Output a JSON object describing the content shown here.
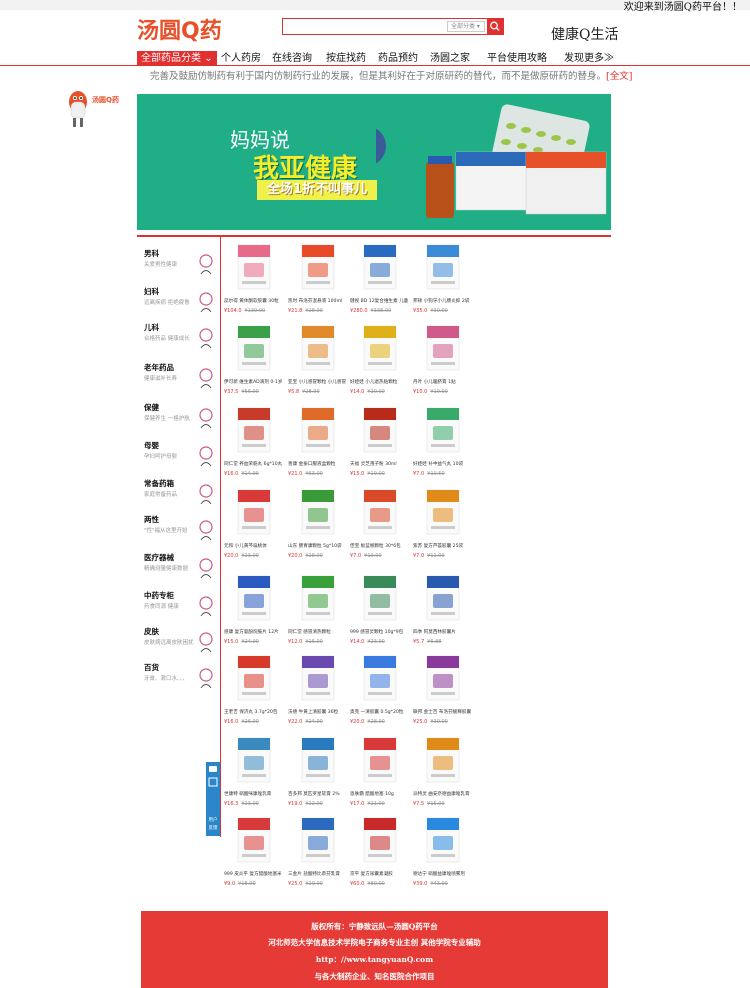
{
  "header": {
    "welcome": "欢迎来到汤圆Q药平台！！",
    "logo_text": "汤圆Q药",
    "search_placeholder": "",
    "search_category": "全部分类",
    "tagline": "健康Q生活"
  },
  "nav": {
    "category_label": "全部药品分类",
    "items": [
      "个人药房",
      "在线咨询",
      "按症找药",
      "药品预约",
      "汤圆之家",
      "平台使用攻略",
      "发现更多≫"
    ]
  },
  "notice": {
    "text": "完善及鼓励仿制药有利于国内仿制药行业的发展，但是其利好在于对原研药的替代，而不是做原研药的替身。",
    "link": "[全文]"
  },
  "mascot_text": "汤圆Q药",
  "banner": {
    "line1": "妈妈说",
    "line2": "我亚健康",
    "line3": "全场1折不叫事儿"
  },
  "categories": [
    {
      "title": "男科",
      "sub": "关爱男性健康",
      "icon": "male-icon"
    },
    {
      "title": "妇科",
      "sub": "远离疾病 拒绝疲惫",
      "icon": "female-icon"
    },
    {
      "title": "儿科",
      "sub": "合格药品 健康成长",
      "icon": "child-icon"
    },
    {
      "title": "老年药品",
      "sub": "健康滋补长寿",
      "icon": "elderly-icon"
    },
    {
      "title": "保健",
      "sub": "保健养生 一格护航",
      "icon": "health-icon"
    },
    {
      "title": "母婴",
      "sub": "孕妇呵护母婴",
      "icon": "mother-baby-icon"
    },
    {
      "title": "常备药箱",
      "sub": "家庭常备药品",
      "icon": "medicine-box-icon"
    },
    {
      "title": "两性",
      "sub": "\"性\"福从这里开始",
      "icon": "gender-icon"
    },
    {
      "title": "医疗器械",
      "sub": "精确测量健康数据",
      "icon": "thermometer-icon"
    },
    {
      "title": "中药专柜",
      "sub": "药食同源 健康",
      "icon": "herb-icon"
    },
    {
      "title": "皮肤",
      "sub": "皮肤病远离皮肤困扰",
      "icon": "skin-icon"
    },
    {
      "title": "百货",
      "sub": "牙膏、漱口水、、、",
      "icon": "goods-icon"
    }
  ],
  "products": [
    {
      "name": "蕊尔得 黄体酮软胶囊 30粒",
      "price": "¥104.0",
      "old": "¥139.00",
      "color": "#e86a8a"
    },
    {
      "name": "凯时 布洛芬混悬液 100ml",
      "price": "¥21.8",
      "old": "¥28.00",
      "color": "#e84a2a"
    },
    {
      "name": "健视 BD 12复合维生素 儿童",
      "price": "¥280.0",
      "old": "¥338.00",
      "color": "#2a6abf"
    },
    {
      "name": "邦顿 小狗牙小儿肠炎抑 2袋",
      "price": "¥35.0",
      "old": "¥39.00",
      "color": "#3a8ad6"
    },
    {
      "name": "伊可新 维生素AD滴剂 0-1岁",
      "price": "¥37.5",
      "old": "¥56.00",
      "color": "#3aa04a"
    },
    {
      "name": "亚宝 小儿感冒颗粒 小儿感冒",
      "price": "¥5.8",
      "old": "¥28.00",
      "color": "#e08a2a"
    },
    {
      "name": "好娃娃 小儿退热贴颗粒",
      "price": "¥14.0",
      "old": "¥20.00",
      "color": "#e0b01a"
    },
    {
      "name": "丹叶 小儿暖脐膏 1贴",
      "price": "¥10.0",
      "old": "¥19.00",
      "color": "#d05a8a"
    },
    {
      "name": "同仁堂 养血荣筋丸 6g*10丸",
      "price": "¥16.0",
      "old": "¥14.99",
      "color": "#c83a2a"
    },
    {
      "name": "善康 金振口服液盒颗粒",
      "price": "¥21.0",
      "old": "¥63.00",
      "color": "#e06a2a"
    },
    {
      "name": "天福 灵芝孢子粉 30ml",
      "price": "¥15.0",
      "old": "¥19.00",
      "color": "#b82a1a"
    },
    {
      "name": "好娃娃 补中益气丸 10袋",
      "price": "¥7.0",
      "old": "¥10.50",
      "color": "#3aaa6a"
    },
    {
      "name": "元和 小儿黄芩扁桃体",
      "price": "¥20.0",
      "old": "¥23.00",
      "color": "#d83a3a"
    },
    {
      "name": "山东 肠胃康颗粒 5g*10袋",
      "price": "¥20.0",
      "old": "¥28.00",
      "color": "#3a9a3a"
    },
    {
      "name": "佳宝 板蓝根颗粒 30*6包",
      "price": "¥7.0",
      "old": "¥19.00",
      "color": "#d84a2a"
    },
    {
      "name": "紫苏 复方芦荟胶囊 25袋",
      "price": "¥7.0",
      "old": "¥11.00",
      "color": "#e08a1a"
    },
    {
      "name": "感康 复方氨酚烷胺片 12片",
      "price": "¥15.0",
      "old": "¥24.00",
      "color": "#2a5abf"
    },
    {
      "name": "同仁堂 感冒清热颗粒",
      "price": "¥12.0",
      "old": "¥15.00",
      "color": "#3aa03a"
    },
    {
      "name": "999 感冒灵颗粒 10g*9包",
      "price": "¥14.0",
      "old": "¥23.00",
      "color": "#3a8a5a"
    },
    {
      "name": "四季 阿莫西林胶囊片",
      "price": "¥5.7",
      "old": "¥6.88",
      "color": "#2a5aaf"
    },
    {
      "name": "王老吉 保济丸 3.7g*20包",
      "price": "¥16.0",
      "old": "¥26.00",
      "color": "#d83a2a"
    },
    {
      "name": "沃德 牛黄上清胶囊 36粒",
      "price": "¥22.0",
      "old": "¥24.00",
      "color": "#6a4aaf"
    },
    {
      "name": "奥克 一清胶囊 0.5g*20粒",
      "price": "¥20.0",
      "old": "¥28.00",
      "color": "#3a7adf"
    },
    {
      "name": "联邦 金士百 布洛芬缓释胶囊",
      "price": "¥25.0",
      "old": "¥39.00",
      "color": "#8a3a9a"
    },
    {
      "name": "世康特 硝酸咪康唑乳膏",
      "price": "¥16.3",
      "old": "¥23.00",
      "color": "#3a8abf"
    },
    {
      "name": "百多邦 莫匹罗星软膏 2%",
      "price": "¥19.0",
      "old": "¥22.00",
      "color": "#2a7abf"
    },
    {
      "name": "恩肤霜 醋酸地塞 10g",
      "price": "¥17.0",
      "old": "¥21.00",
      "color": "#d83a3a"
    },
    {
      "name": "派特灵 曲安奈德益康唑乳膏",
      "price": "¥7.5",
      "old": "¥15.00",
      "color": "#e08a1a"
    },
    {
      "name": "999 皮炎平 复方醋酸地塞米",
      "price": "¥9.0",
      "old": "¥18.00",
      "color": "#d83a3a"
    },
    {
      "name": "三金片 盐酸特比萘芬乳膏",
      "price": "¥25.0",
      "old": "¥29.00",
      "color": "#2a6abf"
    },
    {
      "name": "京平 复方尿囊素凝胶",
      "price": "¥60.0",
      "old": "¥80.00",
      "color": "#c82a2a"
    },
    {
      "name": "德达宁 硝酸益康唑喷雾剂",
      "price": "¥39.0",
      "old": "¥43.00",
      "color": "#2a8adf"
    }
  ],
  "side_button": [
    "用户",
    "反馈"
  ],
  "footer": {
    "line1": "版权所有：宁静致远队—汤圆Q药平台",
    "line2": "河北师范大学信息技术学院电子商务专业主创 其他学院专业辅助",
    "line3": "http：//www.tangyuanQ.com",
    "line4": "与各大制药企业、知名医院合作项目"
  },
  "colors": {
    "brand_red": "#e03030",
    "banner_green": "#1fae86",
    "footer_red": "#e63a36"
  }
}
